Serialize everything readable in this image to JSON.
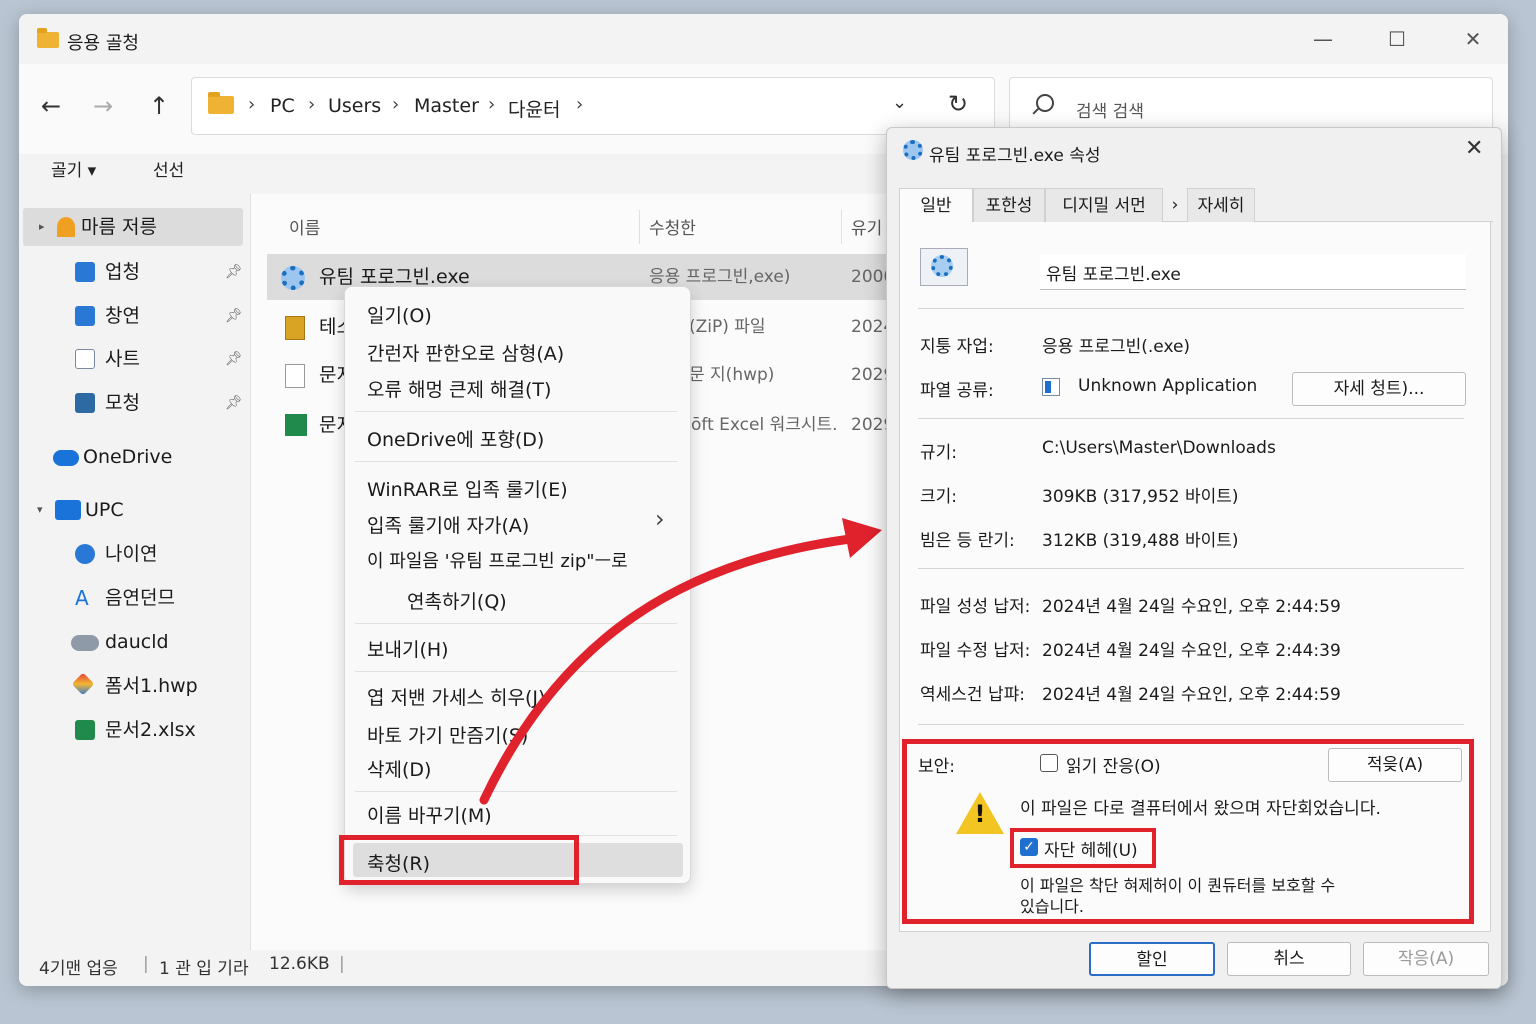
{
  "explorer": {
    "title": "응용 골청",
    "breadcrumb": [
      "PC",
      "Users",
      "Master",
      "다윤터"
    ],
    "search_placeholder": "검색 검색",
    "toolbar": {
      "new_label": "골기 ▾",
      "select_label": "선선"
    },
    "sidebar": {
      "quick_access": "마름 저릉",
      "items": [
        "업청",
        "창연",
        "사트",
        "모청"
      ],
      "onedrive": "OneDrive",
      "pc": "UPC",
      "pc_items": [
        "나이연",
        "음연던므",
        "daucld",
        "폼서1.hwp",
        "문서2.xlsx"
      ]
    },
    "columns": [
      "이름",
      "수청한",
      "유기"
    ],
    "files": [
      {
        "name": "유팀 포로그빈.exe",
        "type": "응용 프로그빈,exe)",
        "date": "2000"
      },
      {
        "name": "테스",
        "type": "(ZiP) 파일",
        "date": "2024"
      },
      {
        "name": "문지",
        "type": "문 지(hwp)",
        "date": "2029"
      },
      {
        "name": "문지",
        "type": "ōft Excel 워크시트.",
        "date": "2029"
      }
    ],
    "status": {
      "count": "4기맨 업응",
      "selected": "1 관 입 기라",
      "size": "12.6KB"
    }
  },
  "context_menu": {
    "items": [
      "일기(O)",
      "간런자 판한오로 삼형(A)",
      "오류 해멍 큰제 해결(T)",
      "OneDrive에 포향(D)",
      "WinRAR로 입족 룰기(E)",
      "입족 룰기애 자가(A)",
      "이 파일음 '유팀 프로그빈 zip\"ㅡ로",
      "연촉하기(Q)",
      "보내기(H)",
      "엽 저밴 가세스 히우(J)",
      "바토 가기 만즘기(S)",
      "삭제(D)",
      "이름 바꾸기(M)",
      "축청(R)"
    ],
    "submenu_arrow": "›"
  },
  "dialog": {
    "title": "유팀 포로그빈.exe 속성",
    "close": "✕",
    "tabs": [
      "일반",
      "포한성",
      "디지밀 서먼",
      "자세히"
    ],
    "tab_more": "›",
    "filename": "유팀 포로그빈.exe",
    "labels": {
      "type": "지퉁 자업:",
      "opens_with": "파열 공류:",
      "location": "규기:",
      "size": "크기:",
      "size_on_disk": "빔은 등 란기:",
      "created": "파일 성성 납저:",
      "modified": "파일 수정 납저:",
      "accessed": "역세스건 납퍄:",
      "security": "보안:"
    },
    "values": {
      "type": "응용 프로그빈(.exe)",
      "opens_with": "Unknown Application",
      "change_button": "자세 청트)...",
      "location": "C:\\Users\\Master\\Downloads",
      "size": "309KB (317,952 바이트)",
      "size_on_disk": "312KB (319,488 바이트)",
      "created": "2024년 4월 24일 수요인, 오후 2:44:59",
      "modified": "2024년 4월 24일 수요인, 오후 2:44:39",
      "accessed": "2024년 4월 24일 수요인, 오후 2:44:59"
    },
    "readonly_label": "읽기 잔응(O)",
    "advanced_button": "적읒(A)",
    "security_message": "이 파일은 다로 결퓨터에서 왔으며 자단회었습니다.",
    "unblock_label": "자단 헤헤(U)",
    "unblock_checked": true,
    "unblock_note_line1": "이 파일은 착단 혀제허이 이 퀀듀터를 보호할 수",
    "unblock_note_line2": "있습니다.",
    "ok_button": "할인",
    "cancel_button": "취스",
    "apply_button": "작응(A)"
  },
  "colors": {
    "highlight_red": "#e0222d",
    "accent_blue": "#1f6fd1",
    "folder_yellow": "#f0b232"
  }
}
